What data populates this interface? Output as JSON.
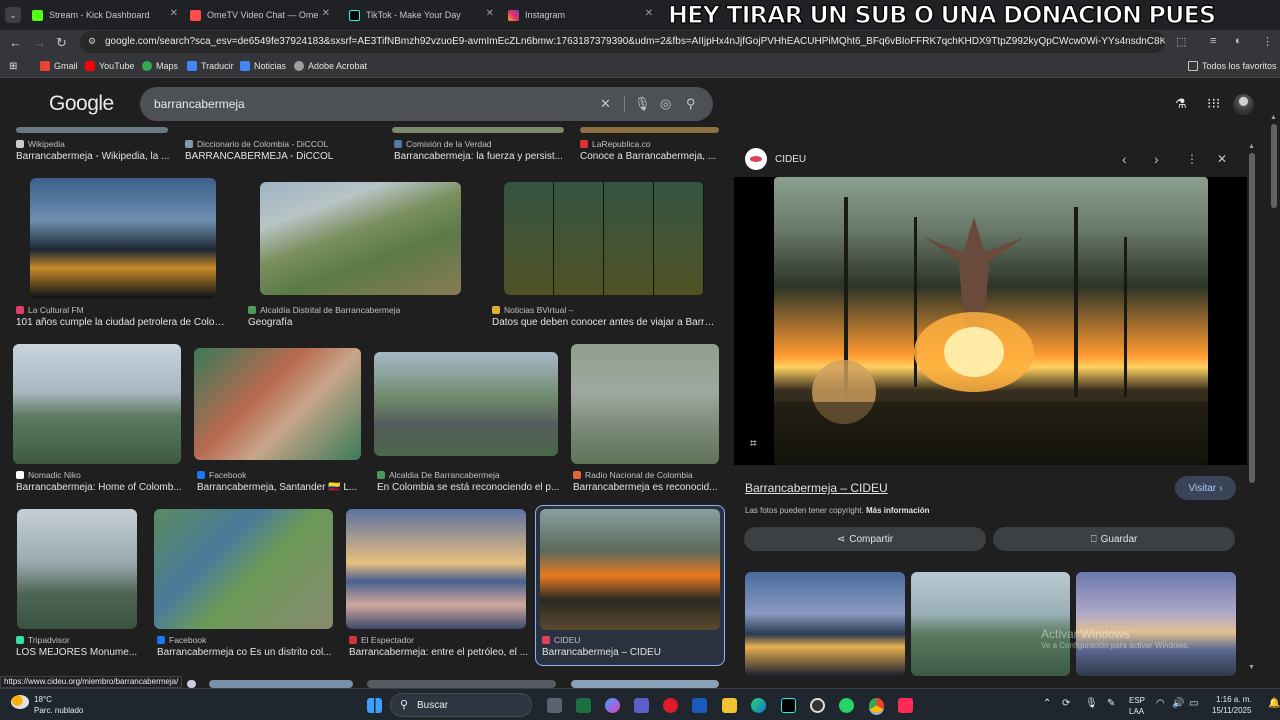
{
  "tabs": [
    {
      "label": "Stream - Kick Dashboard",
      "color": "#53fc18"
    },
    {
      "label": "OmeTV Video Chat — Ome",
      "color": "#ff4d4d"
    },
    {
      "label": "TikTok - Make Your Day",
      "color": "#111111"
    },
    {
      "label": "Instagram",
      "color": "#e1306c"
    }
  ],
  "overlay_text": "HEY TIRAR UN SUB O UNA DONACION PUES",
  "address_url": "google.com/search?sca_esv=de6549fe37924183&sxsrf=AE3TifNBmzh92vzuoE9-avmImEcZLn6bmw:1763187379390&udm=2&fbs=AIIjpHx4nJjfGojPVHhEACUHPiMQht6_BFq6vBIoFFRK7qchKHDX9TtpZ992kyQpCWcw0Wi-YYs4nsdnC8KGzOR7VwQCcH...",
  "bookmarks": [
    "Gmail",
    "YouTube",
    "Maps",
    "Traducir",
    "Noticias",
    "Adobe Acrobat"
  ],
  "bookmarks_all": "Todos los favoritos",
  "google_logo": "Google",
  "search_query": "barrancabermeja",
  "results": [
    {
      "source": "Wikipedia",
      "title": "Barrancabermeja - Wikipedia, la ...",
      "color": "#cccccc"
    },
    {
      "source": "Diccionario de Colombia - DiCCOL",
      "title": "BARRANCABERMEJA - DiCCOL",
      "color": "#8899aa"
    },
    {
      "source": "Comisión de la Verdad",
      "title": "Barrancabermeja: la fuerza y persist...",
      "color": "#5577aa"
    },
    {
      "source": "LaRepublica.co",
      "title": "Conoce a Barrancabermeja, ...",
      "color": "#dd3333"
    },
    {
      "source": "La Cultural FM",
      "title": "101 años cumple la ciudad petrolera de Colom...",
      "color": "#e23c6a"
    },
    {
      "source": "Alcaldía Distrital de Barrancabermeja",
      "title": "Geografía",
      "color": "#4c9a5a"
    },
    {
      "source": "Noticias BVirtual –",
      "title": "Datos que deben conocer antes de viajar a Barran...",
      "color": "#e0b030"
    },
    {
      "source": "Nomadic Niko",
      "title": "Barrancabermeja: Home of Colomb...",
      "color": "#ffffff"
    },
    {
      "source": "Facebook",
      "title": "Barrancabermeja, Santander 🇨🇴 L...",
      "color": "#1877f2"
    },
    {
      "source": "Alcaldia De Barrancabermeja",
      "title": "En Colombia se está reconociendo el p...",
      "color": "#4c9a5a"
    },
    {
      "source": "Radio Nacional de Colombia",
      "title": "Barrancabermeja es reconocid...",
      "color": "#e0663c"
    },
    {
      "source": "Tripadvisor",
      "title": "LOS MEJORES Monume...",
      "color": "#34e0a1"
    },
    {
      "source": "Facebook",
      "title": "Barrancabermeja co Es un distrito col...",
      "color": "#1877f2"
    },
    {
      "source": "El Espectador",
      "title": "Barrancabermeja: entre el petróleo, el ...",
      "color": "#cc3344"
    },
    {
      "source": "CIDEU",
      "title": "Barrancabermeja – CIDEU",
      "color": "#e04060"
    }
  ],
  "panel": {
    "site": "CIDEU",
    "title": "Barrancabermeja – CIDEU",
    "visit": "Visitar",
    "copyright": "Las fotos pueden tener copyright.",
    "more_info": "Más información",
    "share": "Compartir",
    "save": "Guardar"
  },
  "watermark": "Activar Windows",
  "watermark_sub": "Ve a Configuración para activar Windows.",
  "status_url": "https://www.cideu.org/miembro/barrancabermeja/",
  "weather": {
    "temp": "18°C",
    "desc": "Parc. nublado"
  },
  "taskbar_search": "Buscar",
  "tray": {
    "lang1": "ESP",
    "lang2": "LAA",
    "time": "1:16 a. m.",
    "date": "15/11/2025"
  }
}
